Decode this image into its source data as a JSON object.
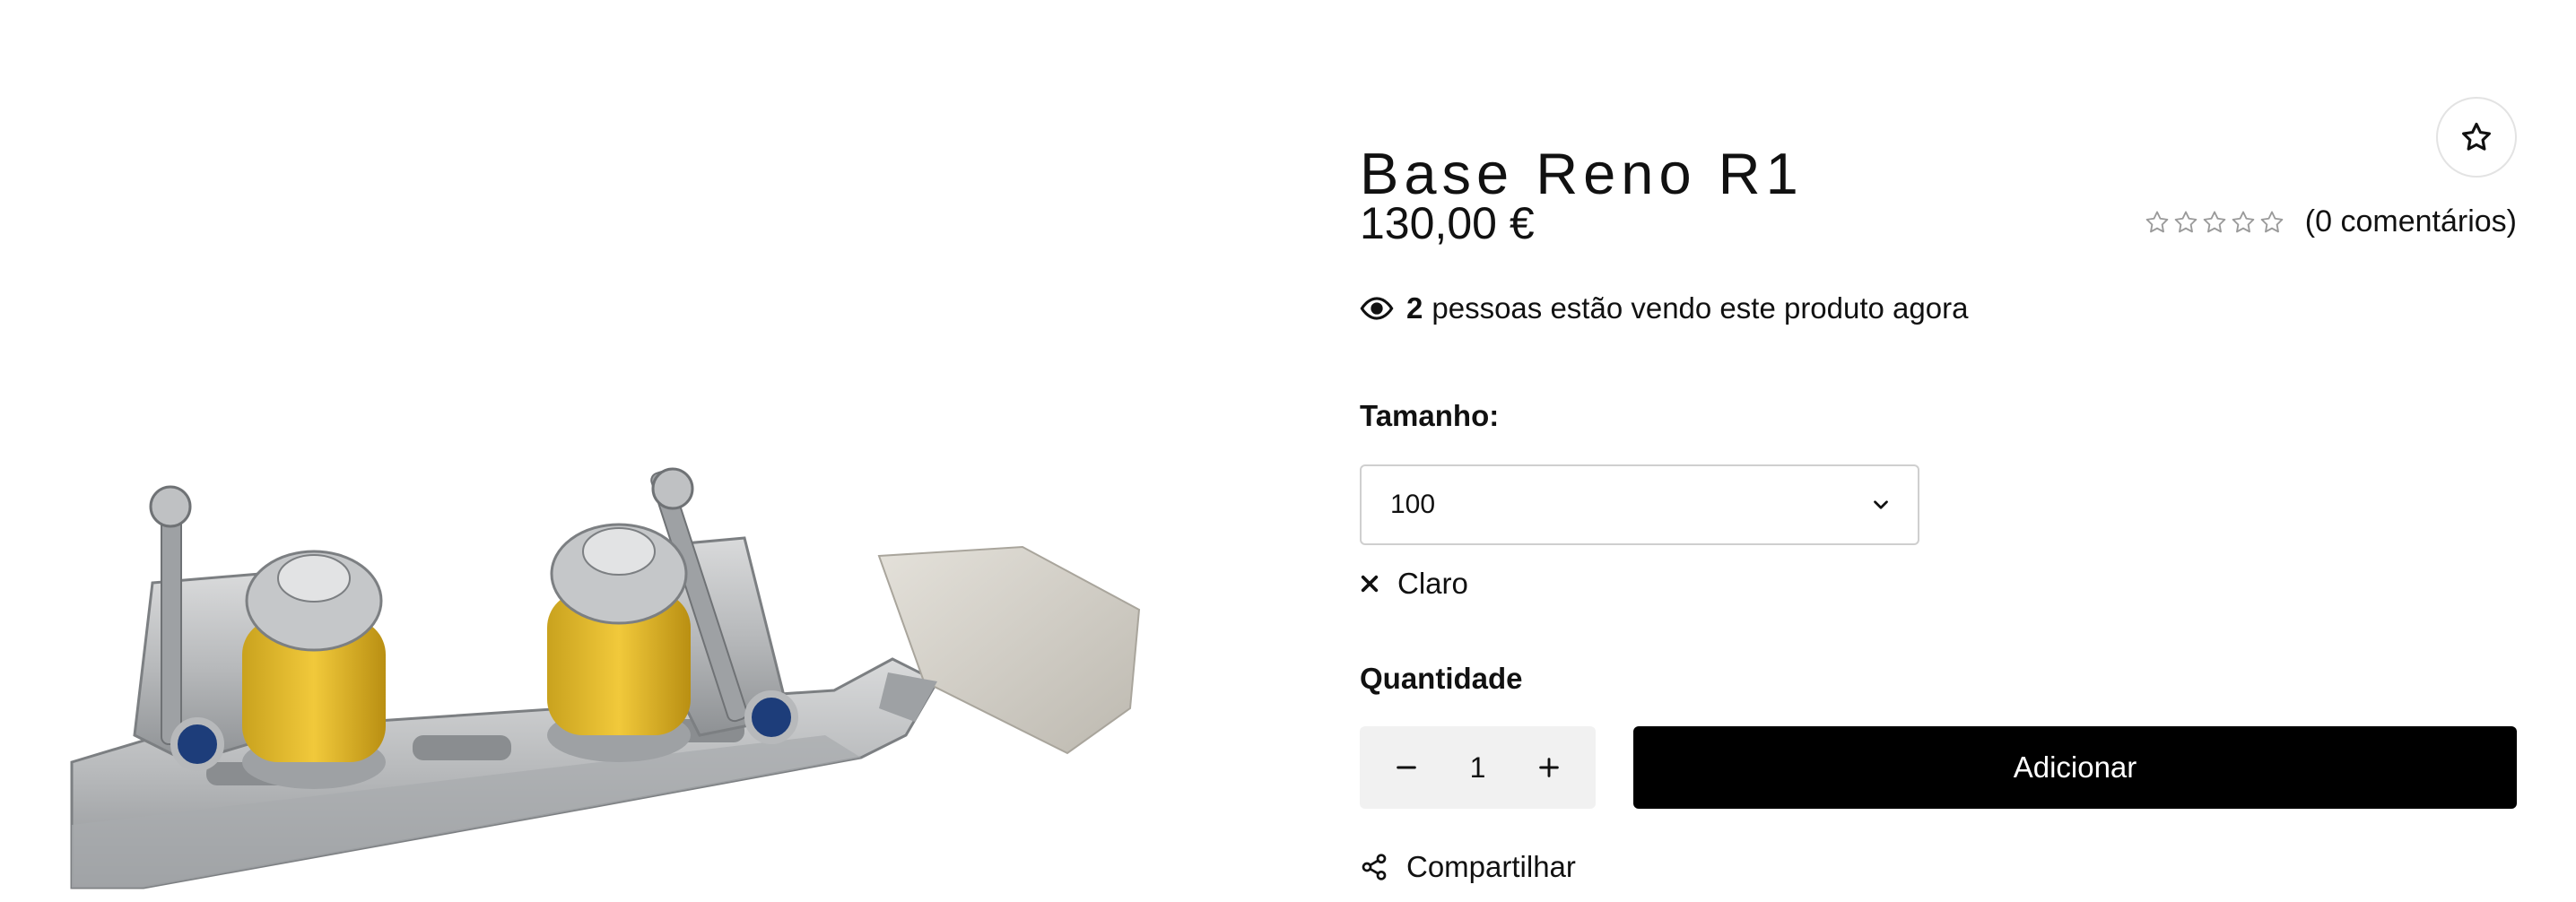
{
  "product": {
    "title": "Base Reno R1",
    "price": "130,00 €",
    "rating": {
      "stars": 0,
      "max": 5,
      "reviews_label": "(0 comentários)"
    },
    "viewers": {
      "count": "2",
      "text": "pessoas estão vendo este produto agora"
    },
    "image_alt": "Base Reno R1"
  },
  "options": {
    "size_label": "Tamanho:",
    "size_value": "100",
    "clear_label": "Claro"
  },
  "purchase": {
    "quantity_label": "Quantidade",
    "quantity_value": "1",
    "add_label": "Adicionar"
  },
  "share": {
    "label": "Compartilhar"
  },
  "icons": {
    "wishlist": "star-icon",
    "viewers": "eye-icon",
    "select": "chevron-down-icon",
    "clear": "close-icon",
    "decrease": "minus-icon",
    "increase": "plus-icon",
    "share": "share-icon"
  },
  "colors": {
    "button_bg": "#000000",
    "button_text": "#ffffff",
    "quantity_bg": "#f1f1f1",
    "star_empty": "#9a9a9a"
  }
}
